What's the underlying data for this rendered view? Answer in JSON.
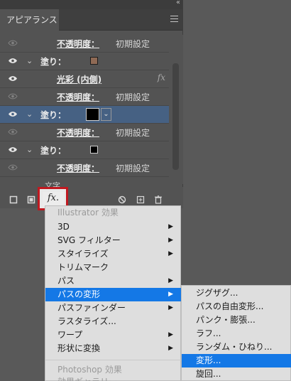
{
  "panel": {
    "collapse_arrows": "‹‹",
    "tab_title": "アピアランス",
    "tab_close": "×"
  },
  "rows": [
    {
      "type": "prop",
      "label": "不透明度：",
      "value": "初期設定"
    },
    {
      "type": "fill",
      "label": "塗り："
    },
    {
      "type": "effect",
      "label": "光彩 (内側)",
      "fx": "fx"
    },
    {
      "type": "prop",
      "label": "不透明度：",
      "value": "初期設定"
    },
    {
      "type": "fill-selected",
      "label": "塗り："
    },
    {
      "type": "prop",
      "label": "不透明度：",
      "value": "初期設定"
    },
    {
      "type": "fill",
      "label": "塗り："
    },
    {
      "type": "prop",
      "label": "不透明度：",
      "value": "初期設定"
    }
  ],
  "text_row": "文字",
  "fx_button": "fx.",
  "effect_menu": {
    "section1_header": "Illustrator 効果",
    "items": [
      {
        "label": "3D",
        "sub": true
      },
      {
        "label": "SVG フィルター",
        "sub": true
      },
      {
        "label": "スタイライズ",
        "sub": true
      },
      {
        "label": "トリムマーク",
        "sub": false
      },
      {
        "label": "パス",
        "sub": true
      },
      {
        "label": "パスの変形",
        "sub": true,
        "highlight": true
      },
      {
        "label": "パスファインダー",
        "sub": true
      },
      {
        "label": "ラスタライズ...",
        "sub": false
      },
      {
        "label": "ワープ",
        "sub": true
      },
      {
        "label": "形状に変換",
        "sub": true
      }
    ],
    "section2_header": "Photoshop 効果",
    "section2_partial": "効果ギャラリー"
  },
  "submenu": {
    "items": [
      {
        "label": "ジグザグ..."
      },
      {
        "label": "パスの自由変形..."
      },
      {
        "label": "パンク・膨張..."
      },
      {
        "label": "ラフ..."
      },
      {
        "label": "ランダム・ひねり..."
      },
      {
        "label": "変形...",
        "highlight": true
      },
      {
        "label": "旋回..."
      }
    ]
  },
  "colors": {
    "panel_bg": "#535353",
    "selected_row": "#466183",
    "highlight": "#1478e6",
    "fx_button_border": "#c01920",
    "fill_swatch_1": "#8f6a55",
    "fill_swatch_2": "#000000",
    "fill_swatch_3": "#000000"
  }
}
